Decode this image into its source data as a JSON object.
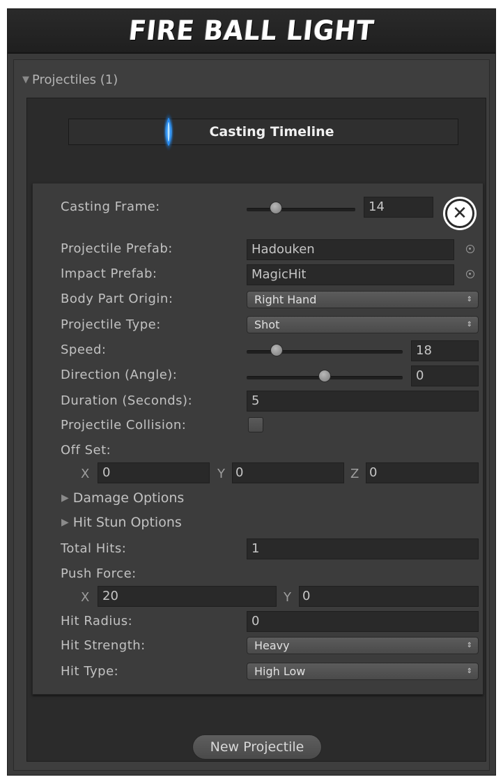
{
  "window": {
    "title": "FIRE BALL LIGHT"
  },
  "projectiles": {
    "foldout_label": "Projectiles (1)",
    "timeline_title": "Casting Timeline",
    "fields": {
      "casting_frame": {
        "label": "Casting Frame:",
        "value": "14"
      },
      "projectile_prefab": {
        "label": "Projectile Prefab:",
        "value": "Hadouken"
      },
      "impact_prefab": {
        "label": "Impact Prefab:",
        "value": "MagicHit"
      },
      "body_part_origin": {
        "label": "Body Part Origin:",
        "value": "Right Hand"
      },
      "projectile_type": {
        "label": "Projectile Type:",
        "value": "Shot"
      },
      "speed": {
        "label": "Speed:",
        "value": "18"
      },
      "direction": {
        "label": "Direction (Angle):",
        "value": "0"
      },
      "duration": {
        "label": "Duration (Seconds):",
        "value": "5"
      },
      "projectile_collision": {
        "label": "Projectile Collision:",
        "checked": false
      },
      "offset": {
        "label": "Off Set:",
        "x_label": "X",
        "x": "0",
        "y_label": "Y",
        "y": "0",
        "z_label": "Z",
        "z": "0"
      },
      "damage_options": {
        "label": "Damage Options"
      },
      "hit_stun_options": {
        "label": "Hit Stun Options"
      },
      "total_hits": {
        "label": "Total Hits:",
        "value": "1"
      },
      "push_force": {
        "label": "Push Force:",
        "x_label": "X",
        "x": "20",
        "y_label": "Y",
        "y": "0"
      },
      "hit_radius": {
        "label": "Hit Radius:",
        "value": "0"
      },
      "hit_strength": {
        "label": "Hit Strength:",
        "value": "Heavy"
      },
      "hit_type": {
        "label": "Hit Type:",
        "value": "High Low"
      }
    },
    "remove_icon": "close-circle-icon",
    "new_button": "New Projectile"
  },
  "colors": {
    "background": "#3a3a3a",
    "field": "#292929",
    "text": "#c2c2c2",
    "accent_glow": "#3aa0ff"
  }
}
